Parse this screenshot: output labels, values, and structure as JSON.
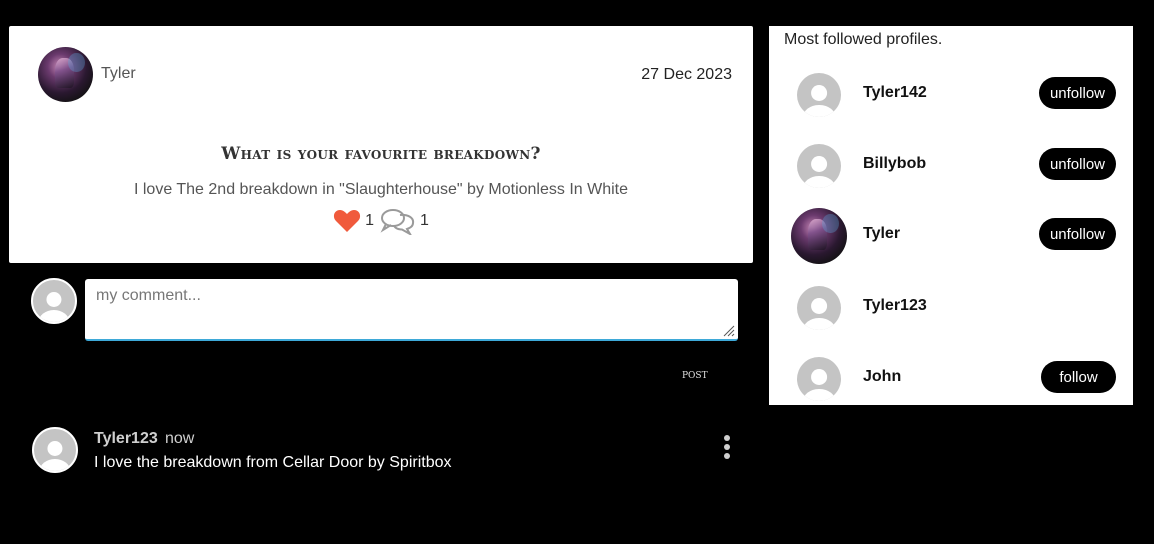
{
  "post": {
    "author": "Tyler",
    "date": "27 Dec 2023",
    "title": "What is your favourite breakdown?",
    "body": "I love The 2nd breakdown in \"Slaughterhouse\" by Motionless In White",
    "likes": "1",
    "comments": "1",
    "like_icon": "heart-icon",
    "comment_icon": "speech-bubbles-icon",
    "like_color": "#f05a3c"
  },
  "composer": {
    "placeholder": "my comment...",
    "value": "",
    "post_label": "post",
    "accent": "#3ea9d8"
  },
  "comment": {
    "author": "Tyler123",
    "time": "now",
    "text": "I love the breakdown from Cellar Door by Spiritbox"
  },
  "profiles": {
    "heading": "Most followed profiles.",
    "items": [
      {
        "name": "Tyler142",
        "button": "unfollow",
        "avatar": "default"
      },
      {
        "name": "Billybob",
        "button": "unfollow",
        "avatar": "default"
      },
      {
        "name": "Tyler",
        "button": "unfollow",
        "avatar": "photo"
      },
      {
        "name": "Tyler123",
        "button": "",
        "avatar": "default"
      },
      {
        "name": "John",
        "button": "follow",
        "avatar": "default"
      }
    ]
  }
}
